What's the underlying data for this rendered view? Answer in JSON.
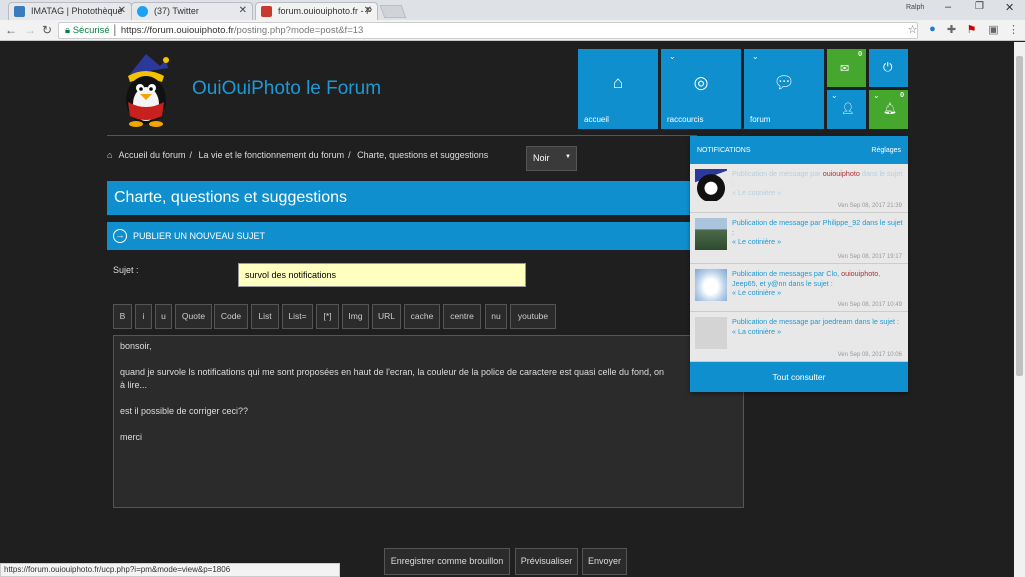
{
  "browser": {
    "tabs": [
      {
        "title": "IMATAG | Photothèque",
        "active": false
      },
      {
        "title": "(37) Twitter",
        "active": false
      },
      {
        "title": "forum.ouiouiphoto.fr - P",
        "active": true
      }
    ],
    "window_user": "Ralph",
    "url_secure": "Sécurisé",
    "url_host": "https://forum.ouiouiphoto.fr",
    "url_path": "/posting.php?mode=post&f=13",
    "status_url": "https://forum.ouiouiphoto.fr/ucp.php?i=pm&mode=view&p=1806"
  },
  "site": {
    "title": "OuiOuiPhoto le Forum",
    "accent_color": "#0f8fcd",
    "green_color": "#45a72e"
  },
  "tiles": [
    {
      "label": "accueil",
      "icon": "home-icon"
    },
    {
      "label": "raccourcis",
      "icon": "lifebuoy-icon"
    },
    {
      "label": "forum",
      "icon": "chat-bubbles-icon"
    }
  ],
  "small_tiles": {
    "messages_count": "0",
    "notifications_count": "0"
  },
  "breadcrumb": [
    "Accueil du forum",
    "La vie et le fonctionnement du forum",
    "Charte, questions et suggestions"
  ],
  "theme_select": "Noir",
  "page_title": "Charte, questions et suggestions",
  "new_topic": "PUBLIER UN NOUVEAU SUJET",
  "form": {
    "subject_label": "Sujet :",
    "subject_value": "survol des notifications",
    "format_buttons": [
      "B",
      "i",
      "u",
      "Quote",
      "Code",
      "List",
      "List=",
      "[*]",
      "Img",
      "URL",
      "cache",
      "centre",
      "nu",
      "youtube"
    ],
    "message_lines": [
      "bonsoir,",
      "",
      "quand je survole ls notifications qui me sont proposées en haut de l'ecran, la couleur de la police de caractere est quasi celle du fond, on",
      "à lire...",
      "",
      "est il possible de corriger ceci??",
      "",
      "merci"
    ],
    "submit_buttons": [
      "Enregistrer comme brouillon",
      "Prévisualiser",
      "Envoyer"
    ]
  },
  "notifications": {
    "header": "NOTIFICATIONS",
    "settings": "Réglages",
    "items": [
      {
        "pre": "Publication de message par ",
        "user": "ouiouiphoto",
        "post": " dans le sujet :",
        "link": "« Le cotinière »",
        "time": "Ven Sep 08, 2017 21:39",
        "faded": true
      },
      {
        "pre": "Publication de message par Philippe_92 dans le sujet :",
        "user": "",
        "post": "",
        "link": "« Le cotinière »",
        "time": "Ven Sep 08, 2017 19:17",
        "faded": false
      },
      {
        "pre": "Publication de messages par Clo, ",
        "user": "ouiouiphoto",
        "post": ", Jeep65, et y@nn dans le sujet :",
        "link": "« Le cotinière »",
        "time": "Ven Sep 08, 2017 10:49",
        "faded": false
      },
      {
        "pre": "Publication de message par joedream dans le sujet :",
        "user": "",
        "post": "",
        "link": "« La cotinière »",
        "time": "Ven Sep 08, 2017 10:06",
        "faded": false
      }
    ],
    "footer": "Tout consulter"
  }
}
